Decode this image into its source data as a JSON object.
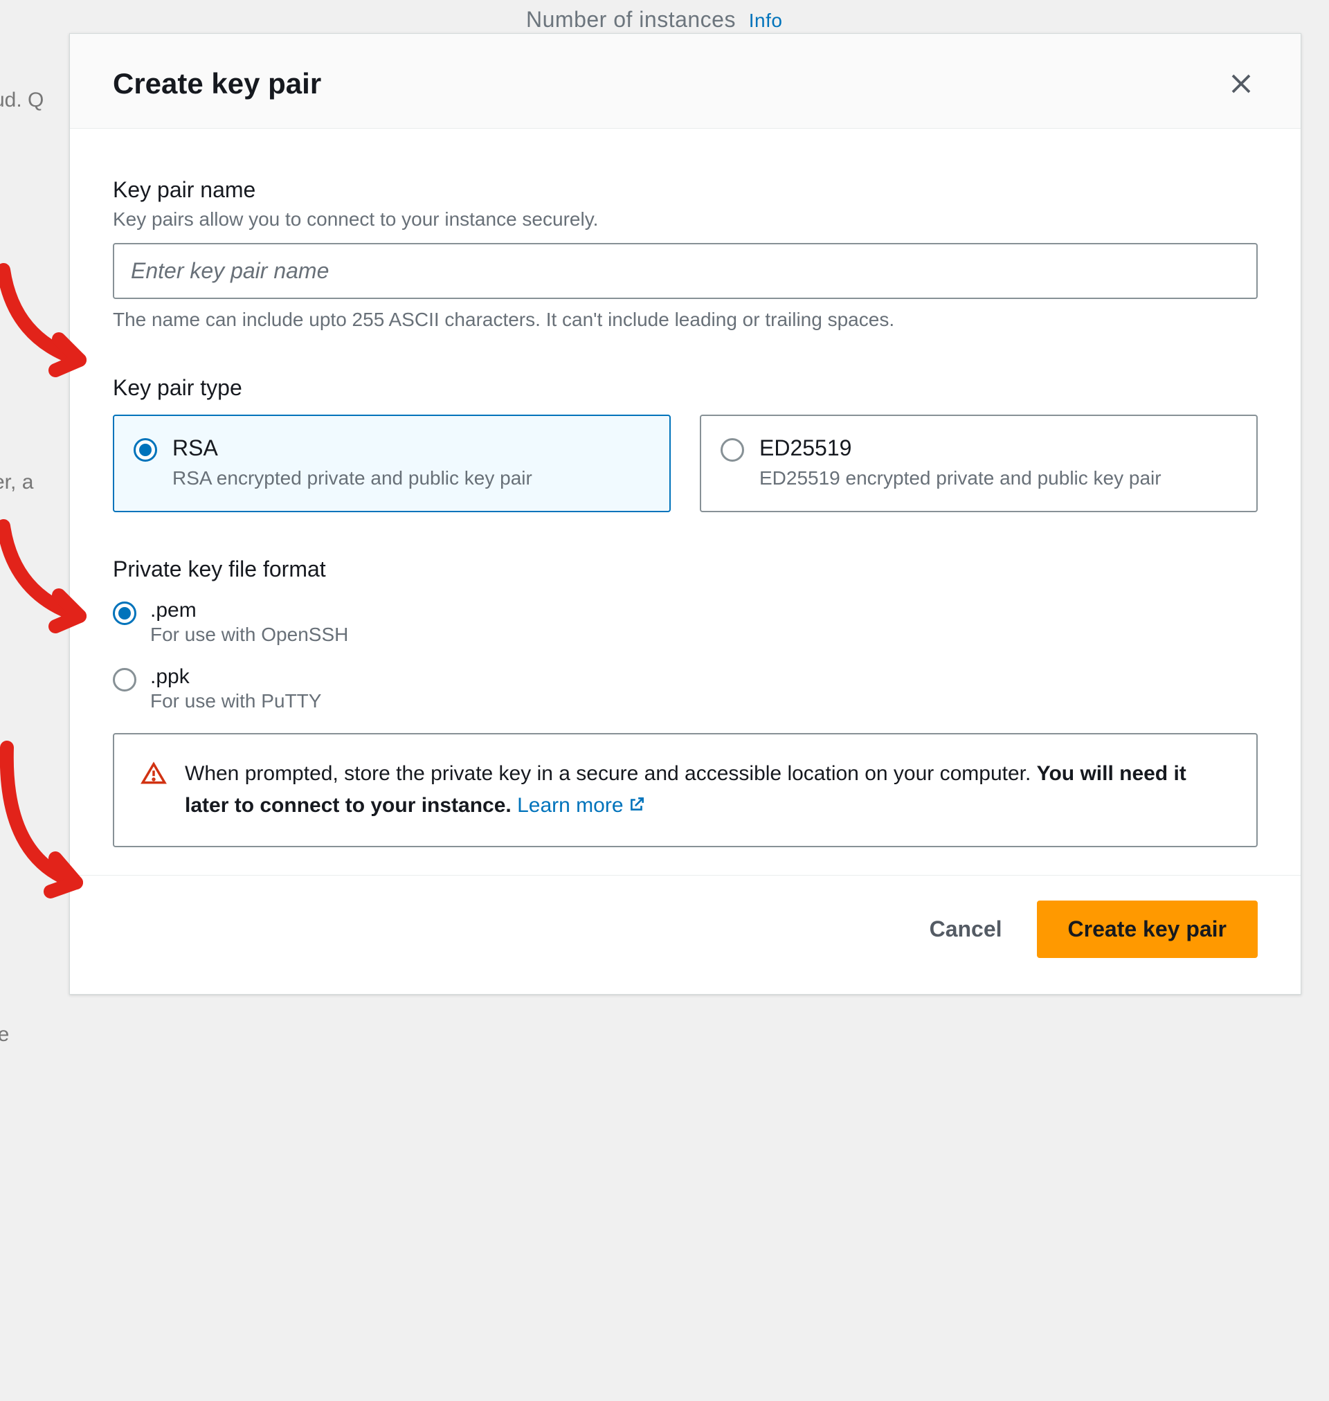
{
  "background": {
    "header_text": "Number of instances",
    "header_info": "Info",
    "left_text_1": "ud. Q",
    "left_text_2": "er, a",
    "left_text_3": "le"
  },
  "modal": {
    "title": "Create key pair",
    "name_section": {
      "label": "Key pair name",
      "description": "Key pairs allow you to connect to your instance securely.",
      "placeholder": "Enter key pair name",
      "hint": "The name can include upto 255 ASCII characters. It can't include leading or trailing spaces."
    },
    "type_section": {
      "label": "Key pair type",
      "options": [
        {
          "title": "RSA",
          "desc": "RSA encrypted private and public key pair",
          "selected": true
        },
        {
          "title": "ED25519",
          "desc": "ED25519 encrypted private and public key pair",
          "selected": false
        }
      ]
    },
    "format_section": {
      "label": "Private key file format",
      "options": [
        {
          "title": ".pem",
          "desc": "For use with OpenSSH",
          "selected": true
        },
        {
          "title": ".ppk",
          "desc": "For use with PuTTY",
          "selected": false
        }
      ]
    },
    "alert": {
      "text_before_bold": "When prompted, store the private key in a secure and accessible location on your computer. ",
      "text_bold": "You will need it later to connect to your instance.",
      "link_text": "Learn more"
    },
    "footer": {
      "cancel": "Cancel",
      "submit": "Create key pair"
    }
  }
}
